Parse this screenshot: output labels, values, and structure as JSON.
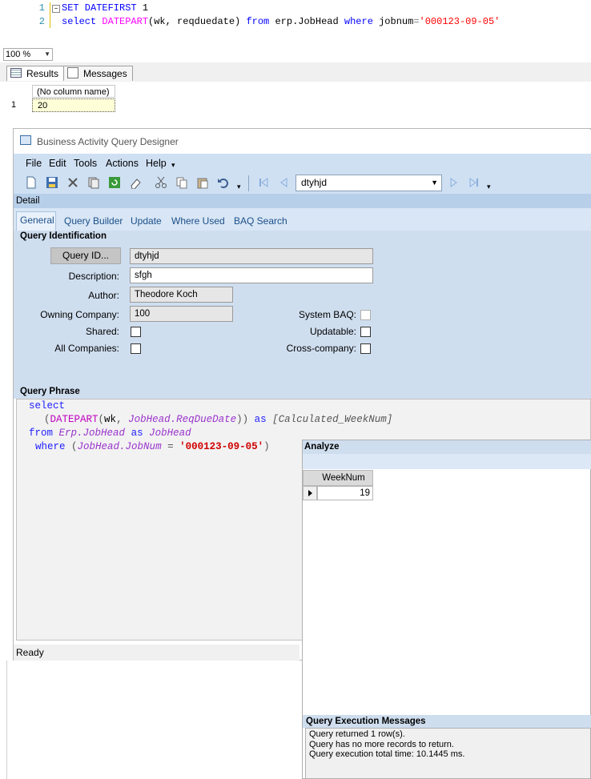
{
  "sql_editor": {
    "line1_num": "1",
    "line1": [
      "SET DATEFIRST",
      " ",
      "1"
    ],
    "line2_num": "2",
    "line2": {
      "kw1": "select",
      "fn": "DATEPART",
      "args": "(wk, reqduedate)",
      "kw2": "from",
      "table": "erp.JobHead",
      "kw3": "where",
      "col": "jobnum",
      "eq": "=",
      "val": "'000123-09-05'"
    }
  },
  "zoom": "100 %",
  "result_tabs": [
    "Results",
    "Messages"
  ],
  "results_grid": {
    "header": "(No column name)",
    "row_num": "1",
    "value": "20"
  },
  "baq": {
    "title": "Business Activity Query Designer",
    "menu": [
      "File",
      "Edit",
      "Tools",
      "Actions",
      "Help"
    ],
    "nav_value": "dtyhjd",
    "detail_label": "Detail",
    "tabs": [
      "General",
      "Query Builder",
      "Update",
      "Where Used",
      "BAQ Search"
    ],
    "query_identification": {
      "heading": "Query Identification",
      "query_id_button": "Query ID...",
      "query_id": "dtyhjd",
      "description_label": "Description:",
      "description": "sfgh",
      "author_label": "Author:",
      "author": "Theodore Koch",
      "owning_company_label": "Owning Company:",
      "owning_company": "100",
      "shared_label": "Shared:",
      "all_companies_label": "All Companies:",
      "system_baq_label": "System BAQ:",
      "updatable_label": "Updatable:",
      "cross_company_label": "Cross-company:"
    },
    "query_phrase": {
      "heading": "Query Phrase",
      "select": "select",
      "fn": "DATEPART",
      "arg1": "wk",
      "arg2": "JobHead.ReqDueDate",
      "as1": "as",
      "alias": "[Calculated_WeekNum]",
      "from": "from",
      "table": "Erp.JobHead",
      "as2": "as",
      "table_alias": "JobHead",
      "where": "where",
      "where_col": "JobHead.JobNum",
      "where_eq": "=",
      "where_val": "'000123-09-05'"
    },
    "status": "Ready"
  },
  "analyze": {
    "heading": "Analyze",
    "column": "WeekNum",
    "value": "19",
    "messages_heading": "Query Execution Messages",
    "messages": [
      "Query returned 1 row(s).",
      "Query has no more records to return.",
      "Query execution total time: 10.1445 ms."
    ]
  },
  "colors": {
    "menu_bg": "#cfe0f3",
    "panel_bg": "#cfdeef",
    "keyword_blue": "#0000ff",
    "string_red": "#ff0000"
  }
}
